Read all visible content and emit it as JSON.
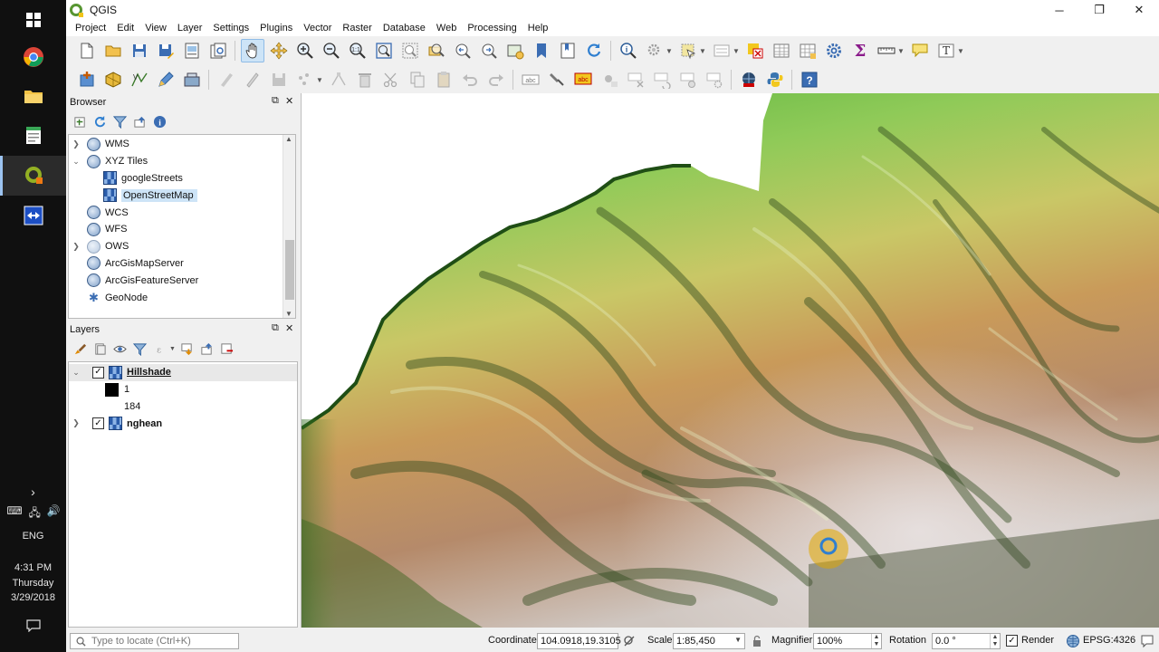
{
  "taskbar": {
    "time": "4:31 PM",
    "day": "Thursday",
    "date": "3/29/2018",
    "language": "ENG",
    "icons": [
      "windows-start-icon",
      "chrome-icon",
      "file-explorer-icon",
      "notepad-icon",
      "qgis-icon",
      "teamviewer-icon"
    ]
  },
  "window": {
    "title": "QGIS",
    "controls": [
      "─",
      "❐",
      "✕"
    ]
  },
  "menu": [
    "Project",
    "Edit",
    "View",
    "Layer",
    "Settings",
    "Plugins",
    "Vector",
    "Raster",
    "Database",
    "Web",
    "Processing",
    "Help"
  ],
  "browser": {
    "title": "Browser",
    "items": [
      {
        "label": "WMS",
        "expanded": false
      },
      {
        "label": "XYZ Tiles",
        "expanded": true
      },
      {
        "label": "googleStreets"
      },
      {
        "label": "OpenStreetMap",
        "selected": true
      },
      {
        "label": "WCS"
      },
      {
        "label": "WFS"
      },
      {
        "label": "OWS",
        "expanded": false
      },
      {
        "label": "ArcGisMapServer"
      },
      {
        "label": "ArcGisFeatureServer"
      },
      {
        "label": "GeoNode"
      }
    ]
  },
  "layers": {
    "title": "Layers",
    "items": [
      {
        "label": "Hillshade",
        "checked": true,
        "expanded": true
      },
      {
        "label": "1"
      },
      {
        "label": "184"
      },
      {
        "label": "nghean",
        "checked": true,
        "expanded": false
      }
    ]
  },
  "status": {
    "locator_placeholder": "Type to locate (Ctrl+K)",
    "coordinate_label": "Coordinate",
    "coordinate_value": "104.0918,19.3105",
    "scale_label": "Scale",
    "scale_value": "1:85,450",
    "magnifier_label": "Magnifier",
    "magnifier_value": "100%",
    "rotation_label": "Rotation",
    "rotation_value": "0.0 °",
    "render_label": "Render",
    "crs": "EPSG:4326"
  },
  "colors": {
    "accent": "#589632",
    "selection": "#cde4f7",
    "taskbar": "#101010"
  }
}
